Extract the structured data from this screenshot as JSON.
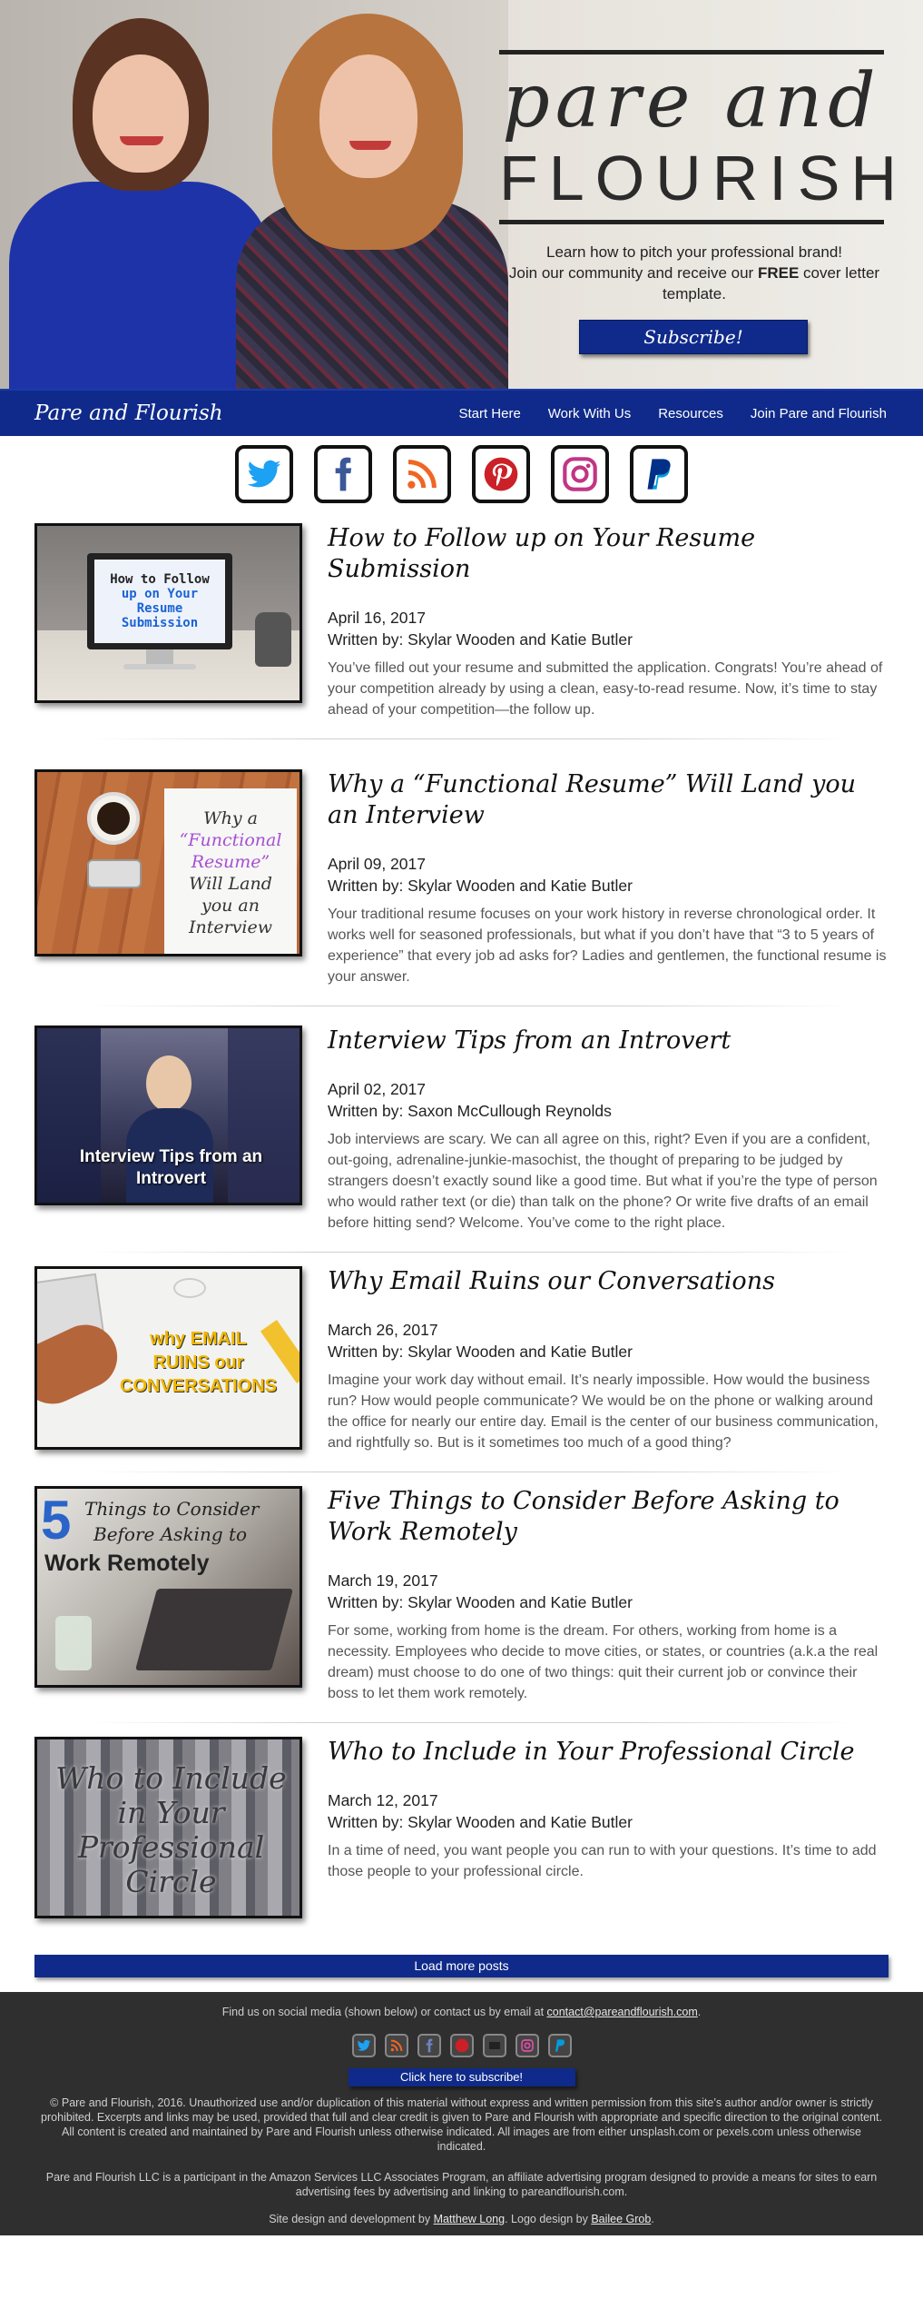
{
  "hero": {
    "brand_script": "pare and",
    "brand_caps": "FLOURISH",
    "line1": "Learn how to pitch your professional brand!",
    "line2_pre": "Join our community and receive our ",
    "line2_bold": "FREE",
    "line2_post": " cover letter template.",
    "subscribe_label": "Subscribe!"
  },
  "nav": {
    "brand": "Pare and Flourish",
    "links": [
      "Start Here",
      "Work With Us",
      "Resources",
      "Join Pare and Flourish"
    ]
  },
  "social_icons": [
    "twitter-icon",
    "facebook-icon",
    "rss-icon",
    "pinterest-icon",
    "instagram-icon",
    "paypal-icon"
  ],
  "posts": [
    {
      "title": "How to Follow up on Your Resume Submission",
      "date": "April 16, 2017",
      "author": "Written by: Skylar Wooden and Katie Butler",
      "excerpt": "You’ve filled out your resume and submitted the application. Congrats! You’re ahead of your competition already by using a clean, easy-to-read resume. Now, it’s time to stay ahead of your competition—the follow up.",
      "thumb_lines": [
        "How to Follow",
        "up on Your",
        "Resume",
        "Submission"
      ]
    },
    {
      "title": "Why a “Functional Resume” Will Land you an Interview",
      "date": "April 09, 2017",
      "author": "Written by: Skylar Wooden and Katie Butler",
      "excerpt": "Your traditional resume focuses on your work history in reverse chronological order. It works well for seasoned professionals, but what if you don’t have that “3 to 5 years of experience” that every job ad asks for? Ladies and gentlemen, the functional resume is your answer.",
      "thumb_lines": [
        "Why a",
        "“Functional",
        "Resume”",
        "Will Land",
        "you an",
        "Interview"
      ]
    },
    {
      "title": "Interview Tips from an Introvert",
      "date": "April 02, 2017",
      "author": "Written by: Saxon McCullough Reynolds",
      "excerpt": "Job interviews are scary. We can all agree on this, right? Even if you are a confident, out-going, adrenaline-junkie-masochist, the thought of preparing to be judged by strangers doesn’t exactly sound like a good time. But what if you’re the type of person who would rather text (or die) than talk on the phone? Or write five drafts of an email before hitting send? Welcome. You’ve come to the right place.",
      "thumb_lines": [
        "Interview Tips from an",
        "Introvert"
      ]
    },
    {
      "title": "Why Email Ruins our Conversations",
      "date": "March 26, 2017",
      "author": "Written by: Skylar Wooden and Katie Butler",
      "excerpt": "Imagine your work day without email. It’s nearly impossible. How would the business run? How would people communicate? We would be on the phone or walking around the office for nearly our entire day. Email is the center of our business communication, and rightfully so. But is it sometimes too much of a good thing?",
      "thumb_lines": [
        "why EMAIL",
        "RUINS our",
        "CONVERSATIONS"
      ]
    },
    {
      "title": "Five Things to Consider Before Asking to Work Remotely",
      "date": "March 19, 2017",
      "author": "Written by: Skylar Wooden and Katie Butler",
      "excerpt": "For some, working from home is the dream. For others, working from home is a necessity. Employees who decide to move cities, or states, or countries (a.k.a the real dream) must choose to do one of two things: quit their current job or convince their boss to let them work remotely.",
      "thumb_lines": [
        "5",
        "Things to Consider",
        "Before Asking to",
        "Work Remotely"
      ]
    },
    {
      "title": "Who to Include in Your Professional Circle",
      "date": "March 12, 2017",
      "author": "Written by: Skylar Wooden and Katie Butler",
      "excerpt": "In a time of need, you want people you can run to with your questions. It’s time to add those people to your professional circle.",
      "thumb_lines": [
        "Who to Include",
        "in Your",
        "Professional",
        "Circle"
      ]
    }
  ],
  "load_more": "Load more posts",
  "footer": {
    "contact_pre": "Find us on social media (shown below) or contact us by email at ",
    "contact_email": "contact@pareandflourish.com",
    "contact_post": ".",
    "subscribe_label": "Click here to subscribe!",
    "copyright": "© Pare and Flourish, 2016. Unauthorized use and/or duplication of this material without express and written permission from this site’s author and/or owner is strictly prohibited. Excerpts and links may be used, provided that full and clear credit is given to Pare and Flourish with appropriate and specific direction to the original content. All content is created and maintained by Pare and Flourish unless otherwise indicated. All images are from either unsplash.com or pexels.com unless otherwise indicated.",
    "amazon": "Pare and Flourish LLC is a participant in the Amazon Services LLC Associates Program, an affiliate advertising program designed to provide a means for sites to earn advertising fees by advertising and linking to pareandflourish.com.",
    "credit_pre": "Site design and development by ",
    "credit_dev": "Matthew Long",
    "credit_mid": ". Logo design by ",
    "credit_logo": "Bailee Grob",
    "credit_post": "."
  },
  "colors": {
    "brand_blue": "#0f2a8a",
    "footer_bg": "#2f2f2f"
  }
}
